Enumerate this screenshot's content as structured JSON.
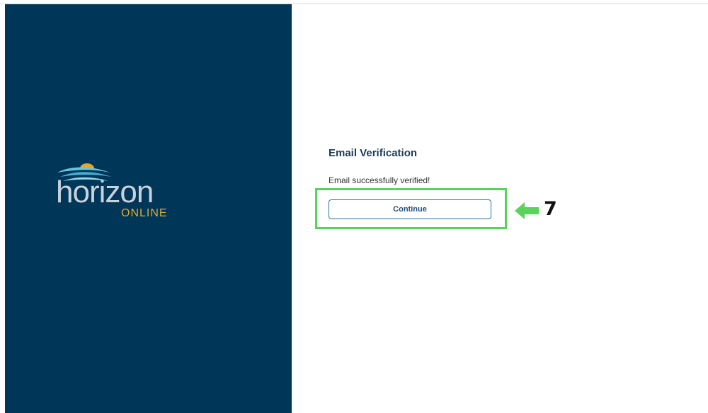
{
  "brand": {
    "logo_word": "horizon",
    "logo_sub": "ONLINE",
    "panel_color": "#003658",
    "accent_color": "#e2a92a"
  },
  "main": {
    "title": "Email Verification",
    "status_message": "Email successfully verified!",
    "continue_label": "Continue"
  },
  "annotation": {
    "step_number": "7",
    "highlight_color": "#5ad35a",
    "arrow_icon": "arrow-left-icon"
  }
}
